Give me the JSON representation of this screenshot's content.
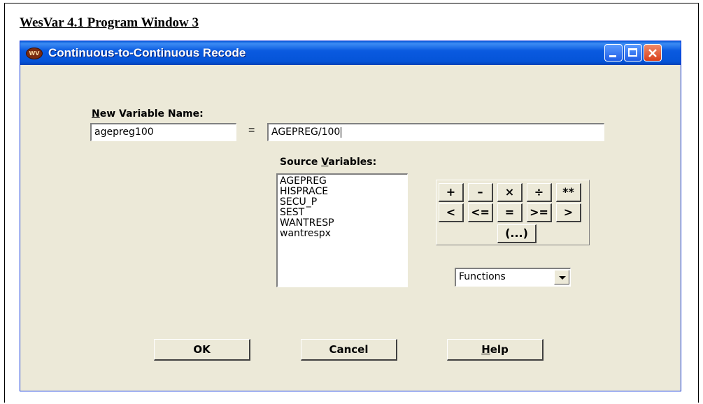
{
  "document": {
    "heading": "WesVar 4.1 Program Window 3"
  },
  "window": {
    "title": "Continuous-to-Continuous Recode",
    "icon_label": "WV"
  },
  "new_variable": {
    "label": "New Variable Name:",
    "mnemonic": "N",
    "label_rest": "ew Variable Name:",
    "value": "agepreg100"
  },
  "equals_sign": "=",
  "expression": {
    "value": "AGEPREG/100"
  },
  "source_variables": {
    "label_pre": "Source ",
    "mnemonic": "V",
    "label_post": "ariables:",
    "items": [
      "AGEPREG",
      "HISPRACE",
      "SECU_P",
      "SEST",
      "WANTRESP",
      "wantrespx"
    ]
  },
  "operators": {
    "row1": [
      "+",
      "–",
      "×",
      "÷",
      "**"
    ],
    "row2": [
      "<",
      "<=",
      "=",
      ">=",
      ">"
    ],
    "paren": "(...)"
  },
  "functions_select": {
    "selected": "Functions"
  },
  "buttons": {
    "ok": "OK",
    "cancel": "Cancel",
    "help_mnemonic": "H",
    "help_rest": "elp"
  }
}
